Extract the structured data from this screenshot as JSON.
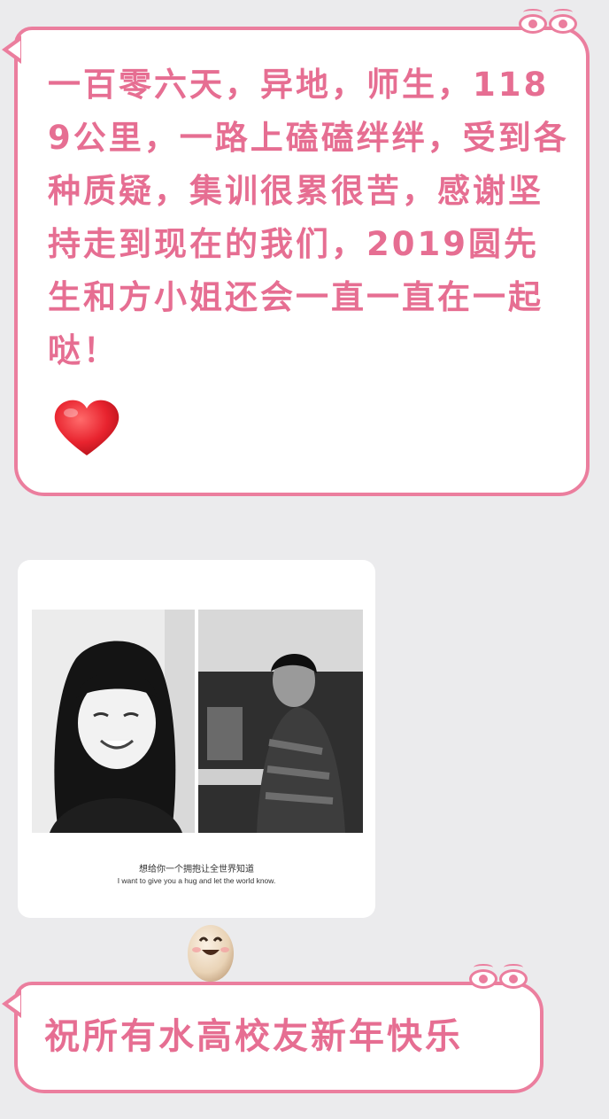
{
  "message_top": {
    "text": "一百零六天，异地，师生，1189公里，一路上磕磕绊绊，受到各种质疑，集训很累很苦，感谢坚持走到现在的我们，2019圆先生和方小姐还会一直一直在一起哒！",
    "emoji": "red-heart-icon"
  },
  "photo_card": {
    "caption_cn": "想给你一个拥抱让全世界知道",
    "caption_en": "I want to give you a hug and let the world know."
  },
  "sticker": {
    "emoji": "smiling-egg-icon"
  },
  "message_bottom": {
    "text": "祝所有水高校友新年快乐"
  },
  "colors": {
    "background": "#ebebed",
    "bubble_border": "#eb7e9e",
    "bubble_text": "#e66e92",
    "heart": "#e8232e"
  }
}
